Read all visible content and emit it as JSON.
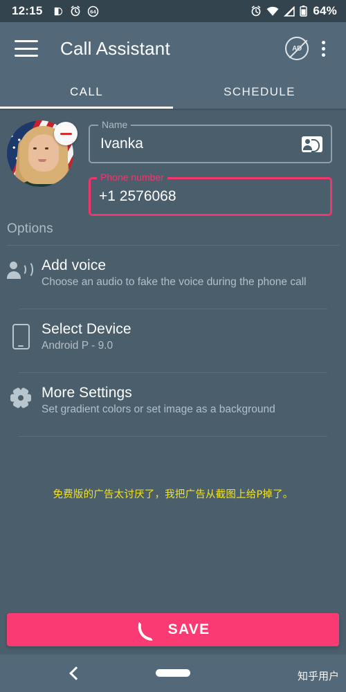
{
  "status_bar": {
    "time": "12:15",
    "battery_percent": "64%",
    "badge_count": "64",
    "left_icons": [
      "dnd-icon",
      "alarm-icon",
      "count-badge-icon"
    ],
    "right_icons": [
      "alarm-icon",
      "wifi-icon",
      "cellular-signal-icon",
      "battery-icon"
    ]
  },
  "app_bar": {
    "title": "Call Assistant",
    "menu_icon": "hamburger-icon",
    "ad_label": "AD",
    "overflow_icon": "kebab-icon"
  },
  "tabs": [
    {
      "label": "CALL",
      "active": true
    },
    {
      "label": "SCHEDULE",
      "active": false
    }
  ],
  "form": {
    "avatar": {
      "remove_badge": "remove-icon"
    },
    "name_field": {
      "label": "Name",
      "value": "Ivanka",
      "action_icon": "contacts-icon",
      "focused": false
    },
    "phone_field": {
      "label": "Phone number",
      "value": "+1 2576068",
      "focused": true
    }
  },
  "options": {
    "header": "Options",
    "items": [
      {
        "icon": "record-voice-icon",
        "title": "Add voice",
        "subtitle": "Choose an audio to fake the voice during the phone call"
      },
      {
        "icon": "smartphone-icon",
        "title": "Select Device",
        "subtitle": "Android P - 9.0"
      },
      {
        "icon": "gear-icon",
        "title": "More Settings",
        "subtitle": "Set gradient colors or set image as a background"
      }
    ]
  },
  "note": "免费版的广告太讨厌了，我把广告从截图上给P掉了。",
  "save_button": {
    "label": "SAVE",
    "icon": "phone-icon"
  },
  "nav_bar": {
    "back_icon": "back-chevron-icon",
    "home_icon": "home-pill-icon"
  },
  "watermark": "知乎用户",
  "colors": {
    "accent_pink": "#FA3A72",
    "background": "#4A5E6B",
    "app_bar": "#53697A",
    "status_bar": "#34444E",
    "note_yellow": "#F2E41E",
    "remove_red": "#D32F2F"
  }
}
